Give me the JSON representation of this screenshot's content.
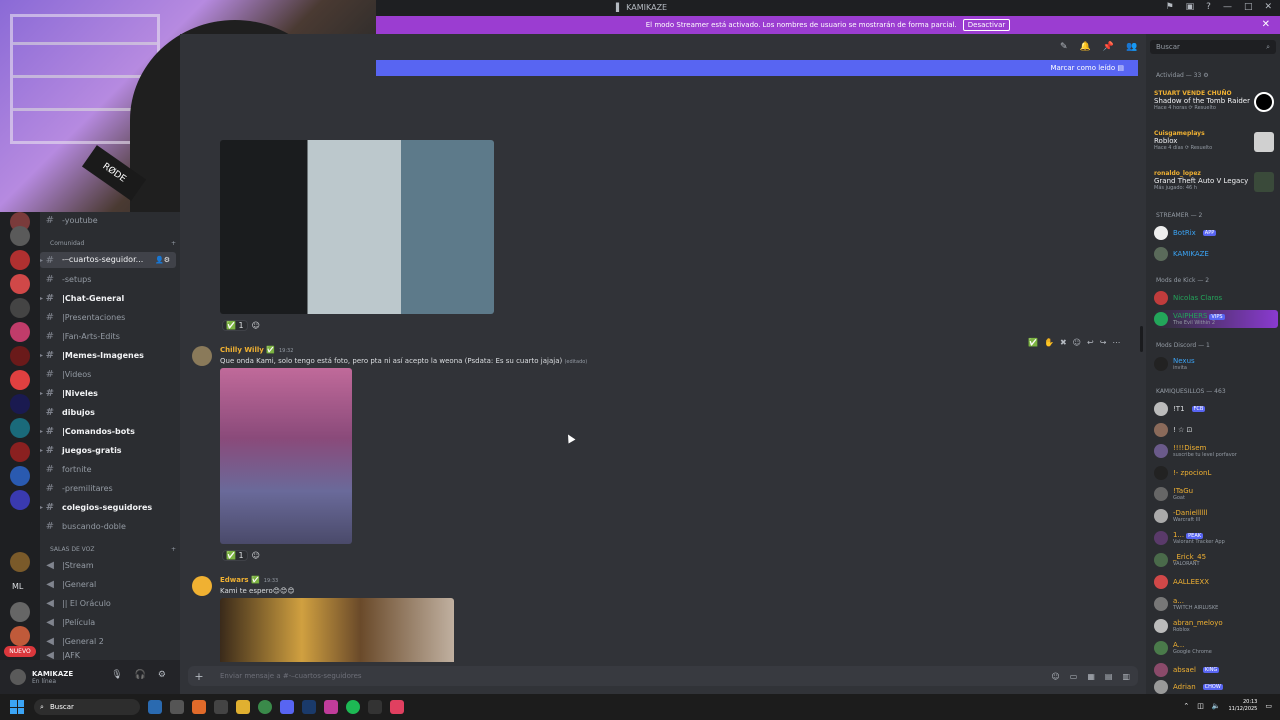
{
  "window": {
    "title": "KAMIKAZE"
  },
  "banner": {
    "text": "El modo Streamer está activado. Los nombres de usuario se mostrarán de forma parcial.",
    "button": "Desactivar"
  },
  "main": {
    "mark_read": "Marcar como leído",
    "composer_placeholder": "Enviar mensaje a #-⎯cuartos-seguidores"
  },
  "channels": [
    {
      "name": "-youtube",
      "bright": false
    },
    {
      "name": "-⎯cuartos-seguidor...",
      "bright": true,
      "active": true
    },
    {
      "name": "-setups",
      "bright": false
    },
    {
      "name": "|Chat-General",
      "bright": true
    },
    {
      "name": "|Presentaciones",
      "bright": false
    },
    {
      "name": "|Fan-Arts-Edits",
      "bright": false
    },
    {
      "name": "|Memes-Imagenes",
      "bright": true
    },
    {
      "name": "|Videos",
      "bright": false
    },
    {
      "name": "|Niveles",
      "bright": true
    },
    {
      "name": "dibujos",
      "bright": true
    },
    {
      "name": "|Comandos-bots",
      "bright": true
    },
    {
      "name": "juegos-gratis",
      "bright": true
    },
    {
      "name": "fortnite",
      "bright": false
    },
    {
      "name": "-premilitares",
      "bright": false
    },
    {
      "name": "colegios-seguidores",
      "bright": true
    },
    {
      "name": "buscando-doble",
      "bright": false
    }
  ],
  "categories": {
    "comunidad": "Comunidad",
    "voice": "SALAS DE VOZ"
  },
  "voice_channels": [
    "|Stream",
    "|General",
    "|| El Oráculo",
    "|Película",
    "|General 2",
    "|AFK"
  ],
  "user": {
    "name": "KAMIKAZE",
    "status": "En línea"
  },
  "rail": {
    "nuevo": "NUEVO",
    "ml": "ML"
  },
  "messages": [
    {
      "author": "Chilly Willy",
      "time": "19:32",
      "text": "Que onda Kami, solo tengo está foto, pero pta ni así acepto la weona (Psdata: Es su cuarto jajaja)",
      "edited": "(editado)",
      "color": "#f0b132"
    },
    {
      "author": "Edwars",
      "time": "19:33",
      "text": "Kami te espero😊😊😊",
      "color": "#f0b132"
    }
  ],
  "reactions": {
    "first": "1",
    "second": "1"
  },
  "search": {
    "placeholder": "Buscar"
  },
  "activity": {
    "header": "Actividad — 33",
    "items": [
      {
        "who": "STUART VENDE CHUÑO",
        "what": "Shadow of the Tomb Raider",
        "meta": "Hace 4 horas  ⟳ Resuelto",
        "color": "#f0b132"
      },
      {
        "who": "Cuisgameplays",
        "what": "Roblox",
        "meta": "Hace 4 días  ⟳ Resuelto",
        "color": "#f0b132"
      },
      {
        "who": "ronaldo_lopez",
        "what": "Grand Theft Auto V Legacy",
        "meta": "Más jugado: 46 h",
        "color": "#f0b132"
      }
    ]
  },
  "members": {
    "streamer_header": "STREAMER — 2",
    "streamer": [
      {
        "name": "BotRix",
        "tag": "APP",
        "color": "#3ba4f5"
      },
      {
        "name": "KAMIKAZE",
        "color": "#3ba4f5"
      }
    ],
    "kick_header": "Mods de Kick — 2",
    "kick": [
      {
        "name": "Nicolas Claros",
        "color": "#23a55a"
      },
      {
        "name": "VAIPHERS",
        "sub": "The Evil Within 2",
        "tag": "VIPS",
        "color": "#23a55a"
      }
    ],
    "discord_header": "Mods Discord — 1",
    "discord": [
      {
        "name": "Nexus",
        "sub": "invita",
        "color": "#3ba4f5"
      }
    ],
    "kamiq_header": "KAMIQUESILLOS — 463",
    "kamiq": [
      {
        "name": "!T1",
        "tag": "FCB",
        "color": "#dbdee1"
      },
      {
        "name": "! ☆ ⊡",
        "color": "#dbdee1"
      },
      {
        "name": "!!!!Disem",
        "sub": "suscribe tu level porfavor",
        "color": "#f0b132"
      },
      {
        "name": "!- zpocionL",
        "color": "#f0b132"
      },
      {
        "name": "!TaGu",
        "sub": "Goat",
        "color": "#f0b132"
      },
      {
        "name": "-Daniellllll",
        "sub": "Warcraft III",
        "color": "#f0b132"
      },
      {
        "name": "1...",
        "sub": "Valorant Tracker App",
        "tag": "PEAK",
        "color": "#f0b132"
      },
      {
        "name": "_Erick_45",
        "sub": "VALORANT",
        "color": "#f0b132"
      },
      {
        "name": "AALLEEXX",
        "color": "#f0b132"
      },
      {
        "name": "a...",
        "sub": "TWITCH AIRLUSKE",
        "color": "#f0b132"
      },
      {
        "name": "abran_meloyo",
        "sub": "Roblox",
        "color": "#f0b132"
      },
      {
        "name": "A...",
        "sub": "Google Chrome",
        "color": "#f0b132"
      },
      {
        "name": "absael",
        "tag": "KING",
        "color": "#f0b132"
      },
      {
        "name": "Adrian",
        "tag": "CHOW",
        "color": "#f0b132"
      }
    ]
  },
  "taskbar": {
    "search": "Buscar",
    "time": "20:13",
    "date": "11/12/2025"
  },
  "colors": {
    "accent": "#5865f2",
    "banner": "#9b3dd1",
    "bg": "#313338"
  }
}
